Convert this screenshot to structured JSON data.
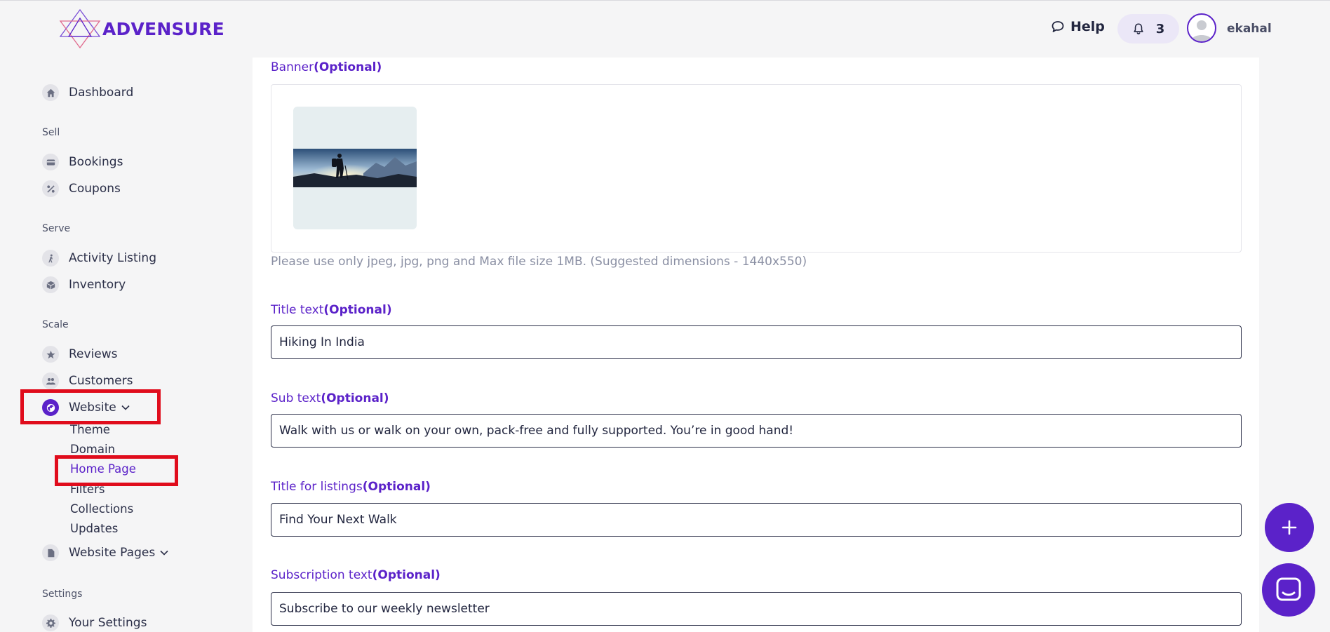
{
  "brand": {
    "name": "ADVENSURE",
    "accent": "#5b22c9"
  },
  "sidebar": {
    "dashboard": "Dashboard",
    "sections": {
      "sell": "Sell",
      "serve": "Serve",
      "scale": "Scale",
      "settings": "Settings"
    },
    "items": {
      "bookings": "Bookings",
      "coupons": "Coupons",
      "activity_listing": "Activity Listing",
      "inventory": "Inventory",
      "reviews": "Reviews",
      "customers": "Customers",
      "website": "Website",
      "website_pages": "Website Pages",
      "your_settings": "Your Settings"
    },
    "website_sub": {
      "theme": "Theme",
      "domain": "Domain",
      "home_page": "Home Page",
      "filters": "Filters",
      "collections": "Collections",
      "updates": "Updates"
    }
  },
  "header": {
    "help": "Help",
    "notifications": "3",
    "username": "ekahal"
  },
  "form": {
    "optional": "(Optional)",
    "banner": {
      "label": "Banner",
      "hint": "Please use only jpeg, jpg, png and Max file size 1MB. (Suggested dimensions - 1440x550)"
    },
    "title_text": {
      "label": "Title text",
      "value": "Hiking In India"
    },
    "sub_text": {
      "label": "Sub text",
      "value": "Walk with us or walk on your own, pack-free and fully supported. You’re in good hand!"
    },
    "listings_title": {
      "label": "Title for listings",
      "value": "Find Your Next Walk"
    },
    "subscription_text": {
      "label": "Subscription text",
      "value": "Subscribe to our weekly newsletter"
    }
  }
}
